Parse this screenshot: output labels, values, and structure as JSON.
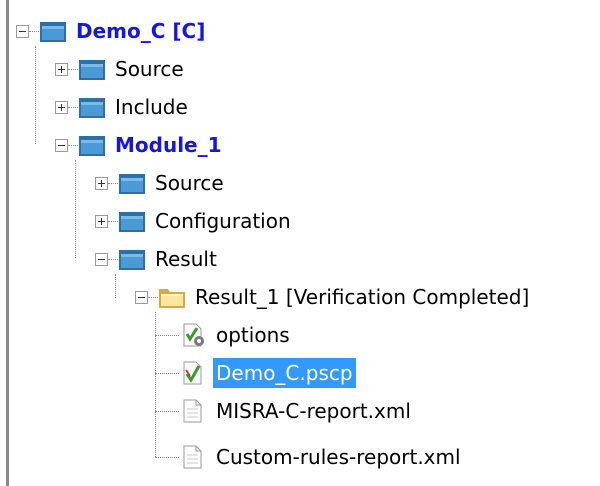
{
  "tree": {
    "root": {
      "label": "Demo_C [C]"
    },
    "source": {
      "label": "Source"
    },
    "include": {
      "label": "Include"
    },
    "module": {
      "label": "Module_1"
    },
    "module_source": {
      "label": "Source"
    },
    "configuration": {
      "label": "Configuration"
    },
    "result": {
      "label": "Result"
    },
    "result_1": {
      "label": "Result_1 [Verification Completed]"
    },
    "options": {
      "label": "options"
    },
    "pscp": {
      "label": "Demo_C.pscp"
    },
    "misra": {
      "label": "MISRA-C-report.xml"
    },
    "custom": {
      "label": "Custom-rules-report.xml"
    }
  },
  "colors": {
    "bold_item": "#1515e6",
    "selection": "#3399ff",
    "folder_blue": "#3f8fd0"
  }
}
